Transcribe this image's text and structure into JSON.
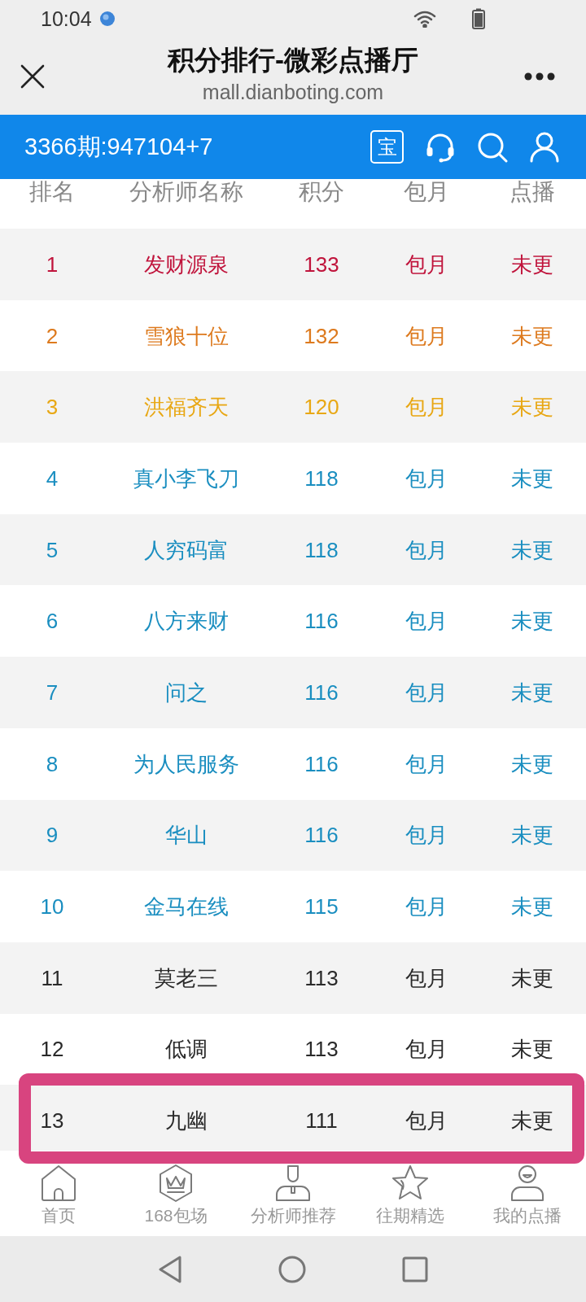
{
  "status_bar": {
    "time": "10:04"
  },
  "title_bar": {
    "title": "积分排行-微彩点播厅",
    "url": "mall.dianboting.com"
  },
  "header_bar": {
    "period_result": "3366期:947104+7",
    "badge_label": "宝"
  },
  "table": {
    "columns": [
      "排名",
      "分析师名称",
      "积分",
      "包月",
      "点播"
    ],
    "rows": [
      {
        "cells": [
          "1",
          "发财源泉",
          "133",
          "包月",
          "未更"
        ],
        "color": "#c0143c",
        "highlighted": false
      },
      {
        "cells": [
          "2",
          "雪狼十位",
          "132",
          "包月",
          "未更"
        ],
        "color": "#dd7a1e",
        "highlighted": false
      },
      {
        "cells": [
          "3",
          "洪福齐天",
          "120",
          "包月",
          "未更"
        ],
        "color": "#e8a713",
        "highlighted": false
      },
      {
        "cells": [
          "4",
          "真小李飞刀",
          "118",
          "包月",
          "未更"
        ],
        "color": "#1a8ec0",
        "highlighted": false
      },
      {
        "cells": [
          "5",
          "人穷码富",
          "118",
          "包月",
          "未更"
        ],
        "color": "#1a8ec0",
        "highlighted": false
      },
      {
        "cells": [
          "6",
          "八方来财",
          "116",
          "包月",
          "未更"
        ],
        "color": "#1a8ec0",
        "highlighted": false
      },
      {
        "cells": [
          "7",
          "问之",
          "116",
          "包月",
          "未更"
        ],
        "color": "#1a8ec0",
        "highlighted": false
      },
      {
        "cells": [
          "8",
          "为人民服务",
          "116",
          "包月",
          "未更"
        ],
        "color": "#1a8ec0",
        "highlighted": false
      },
      {
        "cells": [
          "9",
          "华山",
          "116",
          "包月",
          "未更"
        ],
        "color": "#1a8ec0",
        "highlighted": false
      },
      {
        "cells": [
          "10",
          "金马在线",
          "115",
          "包月",
          "未更"
        ],
        "color": "#1a8ec0",
        "highlighted": false
      },
      {
        "cells": [
          "11",
          "莫老三",
          "113",
          "包月",
          "未更"
        ],
        "color": "#2a2a2a",
        "highlighted": false
      },
      {
        "cells": [
          "12",
          "低调",
          "113",
          "包月",
          "未更"
        ],
        "color": "#2a2a2a",
        "highlighted": false
      },
      {
        "cells": [
          "13",
          "九幽",
          "111",
          "包月",
          "未更"
        ],
        "color": "#2a2a2a",
        "highlighted": true
      }
    ]
  },
  "tab_bar": {
    "items": [
      {
        "kind": "home",
        "label": "首页",
        "selected": false
      },
      {
        "kind": "crown",
        "label": "168包场",
        "selected": false
      },
      {
        "kind": "analyst",
        "label": "分析师推荐",
        "selected": false
      },
      {
        "kind": "star",
        "label": "往期精选",
        "selected": false
      },
      {
        "kind": "profile",
        "label": "我的点播",
        "selected": false
      }
    ]
  }
}
